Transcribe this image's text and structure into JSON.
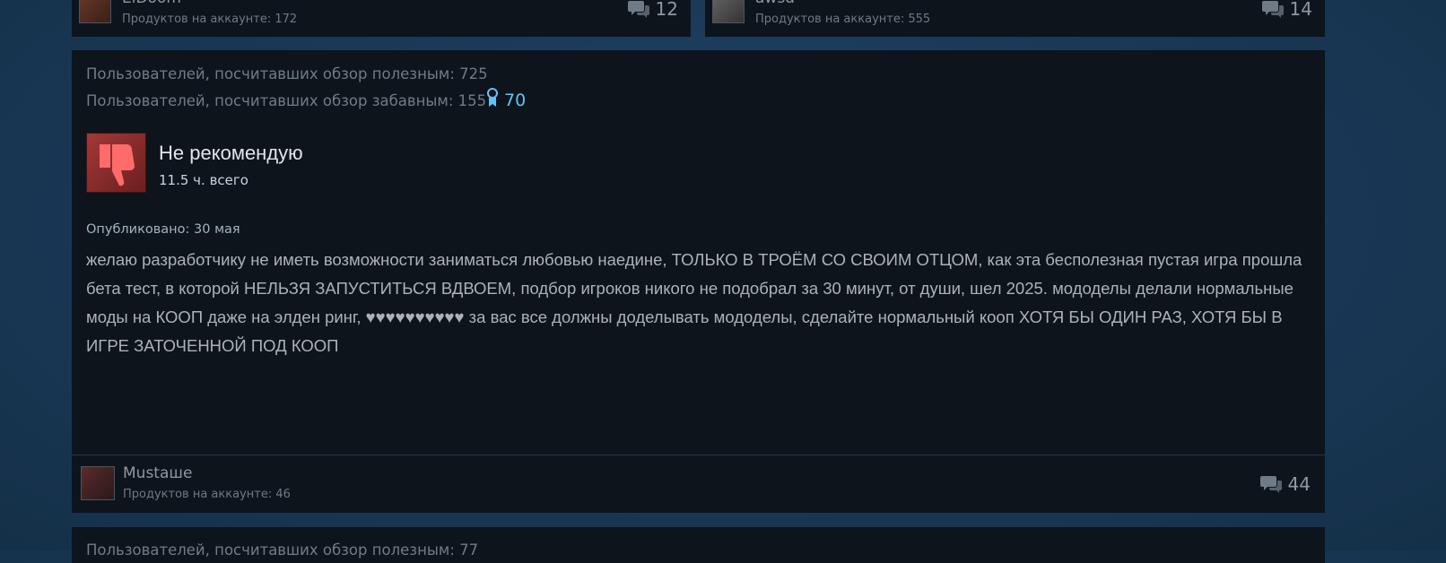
{
  "top_cards": [
    {
      "username": "ElDoom",
      "products": "Продуктов на аккаунте: 172",
      "comments": "12"
    },
    {
      "username": "awsd",
      "products": "Продуктов на аккаунте: 555",
      "comments": "14"
    }
  ],
  "review": {
    "helpful": "Пользователей, посчитавших обзор полезным: 725",
    "funny": "Пользователей, посчитавших обзор забавным: 155",
    "awards": "70",
    "verdict": "Не рекомендую",
    "hours": "11.5 ч. всего",
    "posted": "Опубликовано: 30 мая",
    "text": "желаю разработчику не иметь возможности заниматься любовью наедине, ТОЛЬКО В ТРОЁМ СО СВОИМ ОТЦОМ, как эта бесполезная пустая игра прошла бета тест, в которой НЕЛЬЗЯ ЗАПУСТИТЬСЯ ВДВОЕМ, подбор игроков никого не подобрал за 30 минут, от души, шел 2025. мододелы делали нормальные моды на КООП даже на элден ринг, ♥♥♥♥♥♥♥♥♥♥ за вас все должны доделывать мододелы, сделайте нормальный кооп ХОТЯ БЫ ОДИН РАЗ, ХОТЯ БЫ В ИГРЕ ЗАТОЧЕННОЙ ПОД КООП",
    "author": {
      "name": "Mustaшe",
      "products": "Продуктов на аккаунте: 46",
      "comments": "44"
    }
  },
  "next_review": {
    "helpful": "Пользователей, посчитавших обзор полезным: 77"
  },
  "icons": {
    "award": "award-icon",
    "thumb": "thumbs-down-icon",
    "comments": "comment-bubble-icon"
  },
  "colors": {
    "accent": "#66c0f4",
    "card": "#0d141c",
    "negative": "#a33838"
  }
}
